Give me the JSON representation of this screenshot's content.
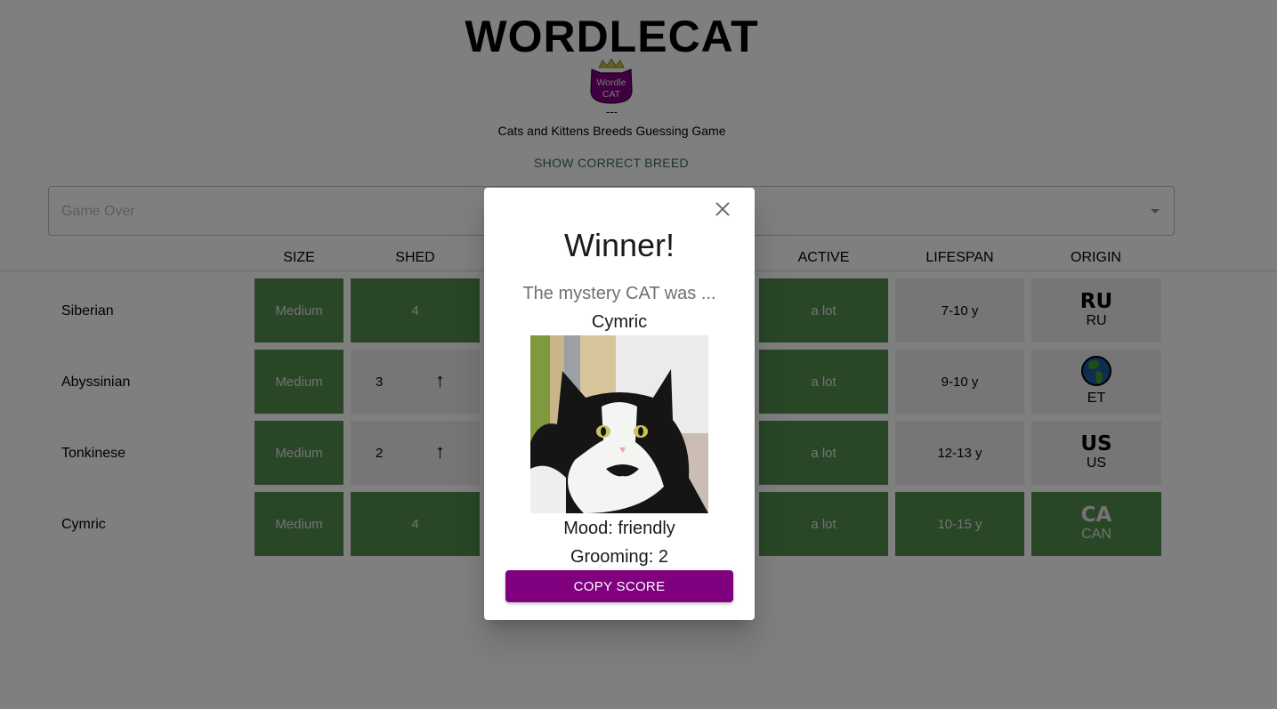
{
  "app": {
    "title": "WORDLECAT",
    "logo_text_line1": "Wordle",
    "logo_text_line2": "CAT",
    "dashes": "---",
    "subtitle": "Cats and Kittens Breeds Guessing Game",
    "show_correct_label": "SHOW CORRECT BREED"
  },
  "search": {
    "placeholder": "Game Over"
  },
  "columns": [
    "SIZE",
    "SHED",
    "",
    "",
    "",
    "ACTIVE",
    "LIFESPAN",
    "ORIGIN"
  ],
  "colors": {
    "correct": "#538d4e",
    "wrong": "#ececec",
    "accent": "#800080"
  },
  "guesses": [
    {
      "breed": "Siberian",
      "size": {
        "value": "Medium",
        "status": "correct"
      },
      "shed": {
        "value": "4",
        "status": "correct",
        "arrow": ""
      },
      "active": {
        "value": "a lot",
        "status": "correct"
      },
      "lifespan": {
        "value": "7-10 y",
        "status": "wrong"
      },
      "origin": {
        "flag": "RU",
        "code": "RU",
        "status": "wrong",
        "icon": ""
      }
    },
    {
      "breed": "Abyssinian",
      "size": {
        "value": "Medium",
        "status": "correct"
      },
      "shed": {
        "value": "3",
        "status": "wrong",
        "arrow": "↑"
      },
      "active": {
        "value": "a lot",
        "status": "correct"
      },
      "lifespan": {
        "value": "9-10 y",
        "status": "wrong"
      },
      "origin": {
        "flag": "",
        "code": "ET",
        "status": "wrong",
        "icon": "globe-icon"
      }
    },
    {
      "breed": "Tonkinese",
      "size": {
        "value": "Medium",
        "status": "correct"
      },
      "shed": {
        "value": "2",
        "status": "wrong",
        "arrow": "↑"
      },
      "active": {
        "value": "a lot",
        "status": "correct"
      },
      "lifespan": {
        "value": "12-13 y",
        "status": "wrong"
      },
      "origin": {
        "flag": "US",
        "code": "US",
        "status": "wrong",
        "icon": ""
      }
    },
    {
      "breed": "Cymric",
      "size": {
        "value": "Medium",
        "status": "correct"
      },
      "shed": {
        "value": "4",
        "status": "correct",
        "arrow": ""
      },
      "active": {
        "value": "a lot",
        "status": "correct"
      },
      "lifespan": {
        "value": "10-15 y",
        "status": "correct"
      },
      "origin": {
        "flag": "CA",
        "code": "CAN",
        "status": "correct",
        "icon": ""
      }
    }
  ],
  "modal": {
    "title": "Winner!",
    "mystery_text": "The mystery CAT was ...",
    "breed": "Cymric",
    "image_alt": "black and white long-haired cat",
    "mood": "Mood: friendly",
    "grooming": "Grooming: 2",
    "copy_label": "COPY SCORE"
  }
}
